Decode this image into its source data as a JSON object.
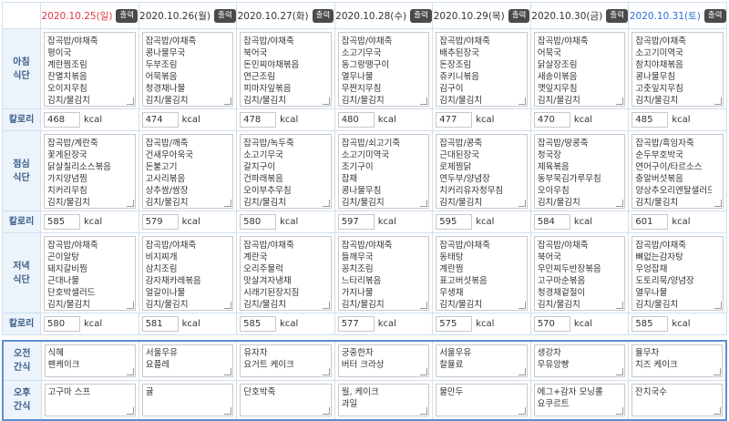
{
  "header": {
    "print_label": "출력",
    "days": [
      {
        "date": "2020.10.25(일)",
        "kind": "sun"
      },
      {
        "date": "2020.10.26(월)",
        "kind": "weekday"
      },
      {
        "date": "2020.10.27(화)",
        "kind": "weekday"
      },
      {
        "date": "2020.10.28(수)",
        "kind": "weekday"
      },
      {
        "date": "2020.10.29(목)",
        "kind": "weekday"
      },
      {
        "date": "2020.10.30(금)",
        "kind": "weekday"
      },
      {
        "date": "2020.10.31(토)",
        "kind": "sat"
      }
    ]
  },
  "colors": {
    "sunday": "#e0393e",
    "saturday": "#2c6fd6",
    "label_bg": "#edf3fb",
    "label_text": "#3a5f8c",
    "border_accent": "#5b8fd0"
  },
  "calorie_label": "칼로리",
  "calorie_unit": "kcal",
  "meals": [
    {
      "label_lines": [
        "아침",
        "식단"
      ],
      "menus": [
        [
          "잡곡밥/야채죽",
          "평이국",
          "계란찜조림",
          "잔멸치볶음",
          "오이지무침",
          "김치/물김치"
        ],
        [
          "잡곡밥/야채죽",
          "콩나물무국",
          "두부조림",
          "어묵볶음",
          "청경채나물",
          "김치/물김치"
        ],
        [
          "잡곡밥/야채죽",
          "북어국",
          "돈민찌야채볶음",
          "연근조림",
          "피마자잎볶음",
          "김치/물김치"
        ],
        [
          "잡곡밥/야채죽",
          "소고기무국",
          "동그랑땡구이",
          "열무나물",
          "무짠지무침",
          "김치/물김치"
        ],
        [
          "잡곡밥/야채죽",
          "배추된장국",
          "돈장조림",
          "쥬키니볶음",
          "김구이",
          "김치/물김치"
        ],
        [
          "잡곡밥/야채죽",
          "어묵국",
          "닭살장조림",
          "새송이볶음",
          "깻잎지무침",
          "김치/물김치"
        ],
        [
          "잡곡밥/야채죽",
          "소고기미역국",
          "참치야채볶음",
          "콩나물무침",
          "고춧잎지무침",
          "김치/물김치"
        ]
      ],
      "calories": [
        "468",
        "474",
        "478",
        "480",
        "477",
        "470",
        "485"
      ]
    },
    {
      "label_lines": [
        "점심",
        "식단"
      ],
      "menus": [
        [
          "잡곡밥/계란죽",
          "꽃게된장국",
          "닭살칠리소스볶음",
          "가지양념찜",
          "치커리무침",
          "김치/물김치"
        ],
        [
          "잡곡밥/깨죽",
          "건새우아욱국",
          "돈불고기",
          "고사리볶음",
          "상추쌈/쌈장",
          "김치/물김치"
        ],
        [
          "잡곡밥/녹두죽",
          "소고기무국",
          "갈치구이",
          "건파래볶음",
          "오이부추무침",
          "김치/물김치"
        ],
        [
          "잡곡밥/쇠고기죽",
          "소고기미역국",
          "조기구이",
          "잡채",
          "콩나물무침",
          "김치/물김치"
        ],
        [
          "잡곡밥/콩죽",
          "근대된장국",
          "로제찜닭",
          "연두부/양념장",
          "치커리유자청무침",
          "김치/물김치"
        ],
        [
          "잡곡밥/땅콩죽",
          "청국장",
          "제육볶음",
          "동부묵김가루무침",
          "오이무침",
          "김치/물김치"
        ],
        [
          "잡곡밥/흑임자죽",
          "순두부호박국",
          "연어구이/타르소스",
          "충알버섯볶음",
          "양상추오리엔탈샐러드",
          "김치/물김치"
        ]
      ],
      "calories": [
        "585",
        "579",
        "580",
        "597",
        "595",
        "584",
        "601"
      ]
    },
    {
      "label_lines": [
        "저녁",
        "식단"
      ],
      "menus": [
        [
          "잡곡밥/야채죽",
          "곤이알탕",
          "돼지갈비찜",
          "근대나물",
          "단호박샐러드",
          "김치/물김치"
        ],
        [
          "잡곡밥/야채죽",
          "비지찌개",
          "삼치조림",
          "감자채카레볶음",
          "얼갈이나물",
          "김치/물김치"
        ],
        [
          "잡곡밥/야채죽",
          "계란국",
          "오리주물럭",
          "맛살겨자냉채",
          "시래기된장지짐",
          "김치/물김치"
        ],
        [
          "잡곡밥/야채죽",
          "들깨무국",
          "꽁치조림",
          "느타리볶음",
          "가지나물",
          "김치/물김치"
        ],
        [
          "잡곡밥/야채죽",
          "동태탕",
          "계란찜",
          "표고버섯볶음",
          "무생채",
          "김치/물김치"
        ],
        [
          "잡곡밥/야채죽",
          "북어국",
          "우민찌두반장볶음",
          "고구마순볶음",
          "청경채겉절이",
          "김치/물김치"
        ],
        [
          "잡곡밥/야채죽",
          "뼈없는감자탕",
          "우엉잡채",
          "도토리묵/양념장",
          "열무나물",
          "김치/물김치"
        ]
      ],
      "calories": [
        "580",
        "581",
        "585",
        "577",
        "575",
        "570",
        "585"
      ]
    }
  ],
  "snacks": [
    {
      "label_lines": [
        "오전",
        "간식"
      ],
      "items": [
        [
          "식혜",
          "팬케이크"
        ],
        [
          "서울우유",
          "요플레"
        ],
        [
          "유자차",
          "요거트 케이크"
        ],
        [
          "궁중한차",
          "버터 크라상"
        ],
        [
          "서울우유",
          "찰율료"
        ],
        [
          "생강차",
          "우유앙빵"
        ],
        [
          "율무차",
          "치즈 케이크"
        ]
      ]
    },
    {
      "label_lines": [
        "오후",
        "간식"
      ],
      "items": [
        [
          "고구마 스프"
        ],
        [
          "귤"
        ],
        [
          "단호박죽"
        ],
        [
          "월, 케이크",
          "과일"
        ],
        [
          "물만두"
        ],
        [
          "에그+감자 모닝롤",
          "요쿠르트"
        ],
        [
          "잔치국수"
        ]
      ]
    }
  ]
}
